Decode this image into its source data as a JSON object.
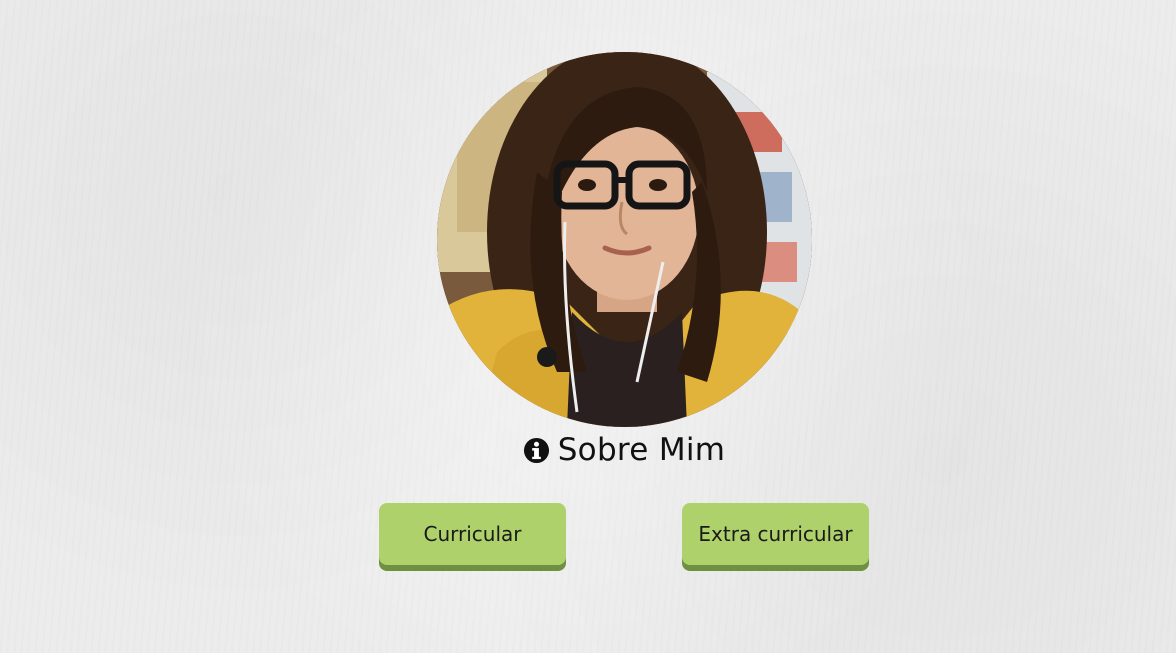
{
  "profile": {
    "photo_alt": "profile-photo",
    "heading": "Sobre Mim",
    "heading_icon": "info-circle-icon"
  },
  "buttons": {
    "curricular": "Curricular",
    "extra_curricular": "Extra curricular"
  },
  "colors": {
    "background": "#ececec",
    "button_fill": "#afd16b",
    "button_shadow": "#6f9040",
    "text": "#111111"
  }
}
